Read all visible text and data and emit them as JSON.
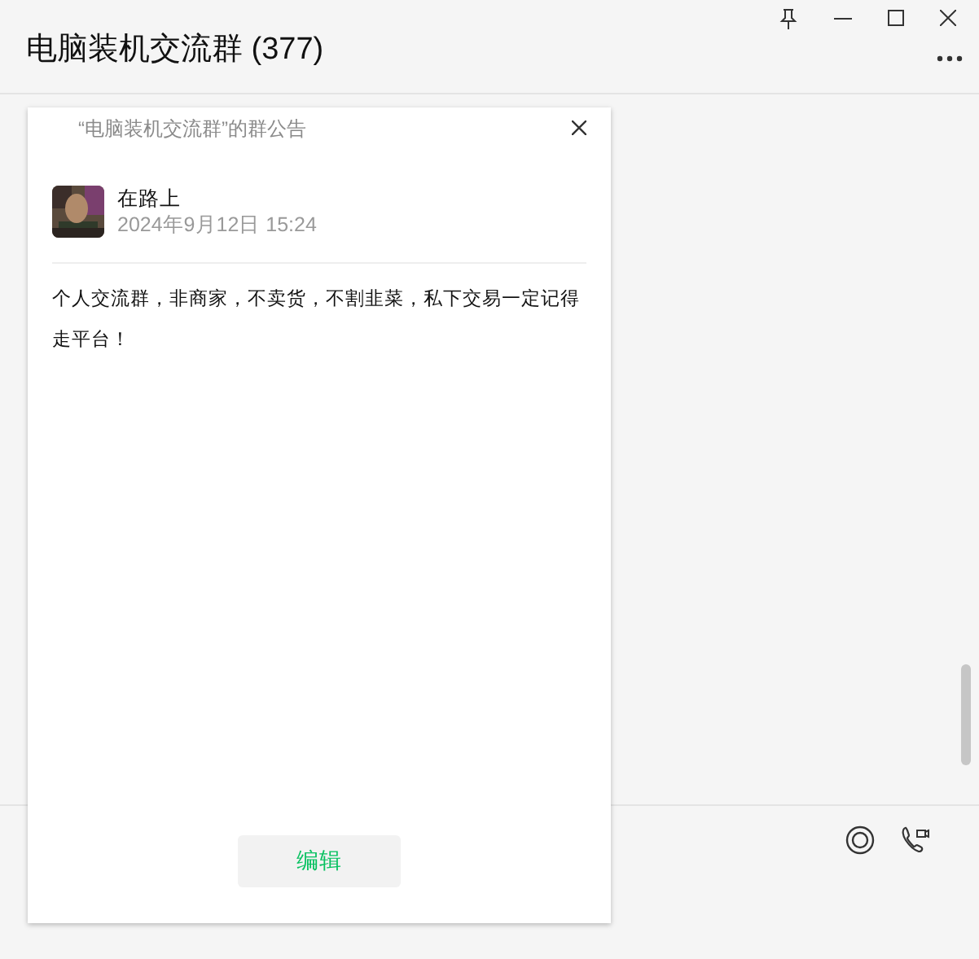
{
  "window": {
    "title": "电脑装机交流群 (377)"
  },
  "announcement": {
    "title": "“电脑装机交流群”的群公告",
    "author": "在路上",
    "time": "2024年9月12日 15:24",
    "text": "个人交流群，非商家，不卖货，不割韭菜，私下交易一定记得走平台！",
    "edit_button": "编辑"
  }
}
